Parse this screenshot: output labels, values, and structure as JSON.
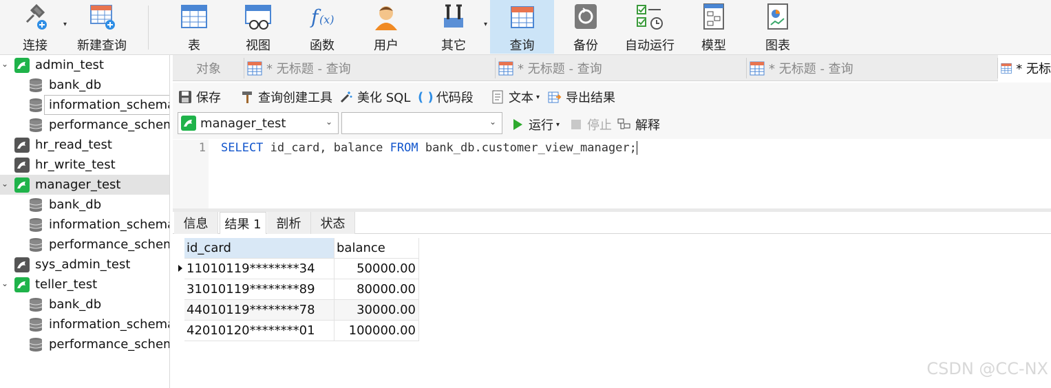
{
  "toolbar": {
    "connect": "连接",
    "new_query": "新建查询",
    "table": "表",
    "view": "视图",
    "function": "函数",
    "user": "用户",
    "other": "其它",
    "query": "查询",
    "backup": "备份",
    "auto_run": "自动运行",
    "model": "模型",
    "chart": "图表"
  },
  "sidebar": {
    "items": [
      {
        "label": "admin_test"
      },
      {
        "label": "bank_db"
      },
      {
        "label": "information_schema"
      },
      {
        "label": "performance_schema"
      },
      {
        "label": "hr_read_test"
      },
      {
        "label": "hr_write_test"
      },
      {
        "label": "manager_test"
      },
      {
        "label": "bank_db"
      },
      {
        "label": "information_schema"
      },
      {
        "label": "performance_schema"
      },
      {
        "label": "sys_admin_test"
      },
      {
        "label": "teller_test"
      },
      {
        "label": "bank_db"
      },
      {
        "label": "information_schema"
      },
      {
        "label": "performance_schema"
      }
    ]
  },
  "tabs": {
    "objects": "对象",
    "t1": "* 无标题 - 查询",
    "t2": "* 无标题 - 查询",
    "t3": "* 无标题 - 查询",
    "t4": "* 无标"
  },
  "subbar": {
    "save": "保存",
    "query_builder": "查询创建工具",
    "beautify": "美化 SQL",
    "snippet": "代码段",
    "text": "文本",
    "export": "导出结果",
    "connection": "manager_test",
    "database": "",
    "run": "运行",
    "stop": "停止",
    "explain": "解释"
  },
  "editor": {
    "line": "1",
    "kw_select": "SELECT",
    "part1": " id_card, balance ",
    "kw_from": "FROM",
    "part2": " bank_db.customer_view_manager;"
  },
  "result_tabs": {
    "info": "信息",
    "result1": "结果 1",
    "profile": "剖析",
    "status": "状态"
  },
  "grid": {
    "columns": [
      "id_card",
      "balance"
    ],
    "rows": [
      [
        "11010119********34",
        "50000.00"
      ],
      [
        "31010119********89",
        "80000.00"
      ],
      [
        "44010119********78",
        "30000.00"
      ],
      [
        "42010120********01",
        "100000.00"
      ]
    ]
  },
  "watermark": "CSDN @CC-NX",
  "colors": {
    "accent": "#1155cc",
    "active_tab": "#cce4f7",
    "mysql_green": "#1fb34a"
  }
}
